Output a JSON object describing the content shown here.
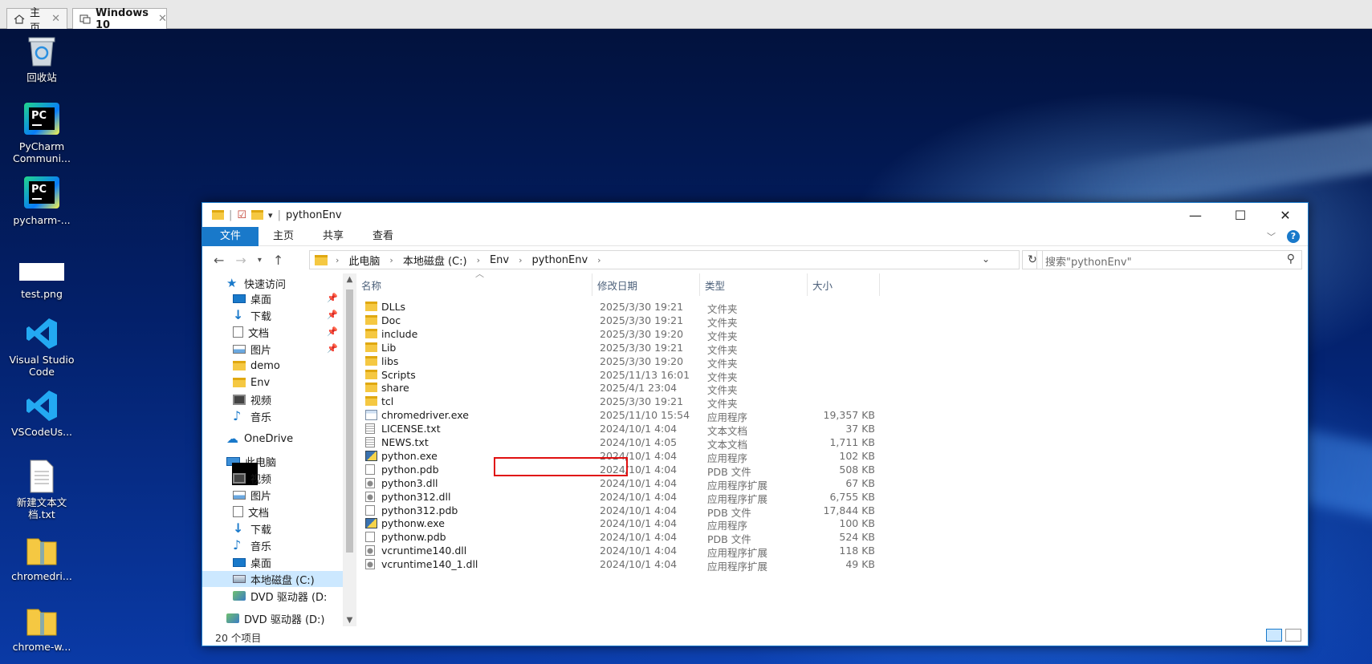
{
  "host_tabs": [
    {
      "label": "主页"
    },
    {
      "label": "Windows 10"
    }
  ],
  "desktop_icons": [
    {
      "label": "回收站"
    },
    {
      "label": "PyCharm Communi..."
    },
    {
      "label": "pycharm-..."
    },
    {
      "label": "test.png"
    },
    {
      "label": "Visual Studio Code"
    },
    {
      "label": "VSCodeUs..."
    },
    {
      "label": "新建文本文档.txt"
    },
    {
      "label": "chromedri..."
    },
    {
      "label": "chrome-w..."
    }
  ],
  "explorer": {
    "title": "pythonEnv",
    "ribbon_tabs": [
      "文件",
      "主页",
      "共享",
      "查看"
    ],
    "breadcrumb": [
      "此电脑",
      "本地磁盘 (C:)",
      "Env",
      "pythonEnv"
    ],
    "search_placeholder": "搜索\"pythonEnv\"",
    "columns": [
      "名称",
      "修改日期",
      "类型",
      "大小"
    ],
    "sidebar": [
      {
        "label": "快速访问",
        "icon": "star-icon"
      },
      {
        "label": "桌面",
        "icon": "desktop-icon",
        "pinned": true
      },
      {
        "label": "下载",
        "icon": "download-icon",
        "pinned": true
      },
      {
        "label": "文档",
        "icon": "document-icon",
        "pinned": true
      },
      {
        "label": "图片",
        "icon": "picture-icon",
        "pinned": true
      },
      {
        "label": "demo",
        "icon": "folder-icon"
      },
      {
        "label": "Env",
        "icon": "folder-icon"
      },
      {
        "label": "视频",
        "icon": "video-icon"
      },
      {
        "label": "音乐",
        "icon": "music-icon"
      },
      {
        "label": "OneDrive",
        "icon": "cloud-icon"
      },
      {
        "label": "此电脑",
        "icon": "computer-icon"
      },
      {
        "label": "视频",
        "icon": "video-icon"
      },
      {
        "label": "图片",
        "icon": "picture-icon"
      },
      {
        "label": "文档",
        "icon": "document-icon"
      },
      {
        "label": "下载",
        "icon": "download-icon"
      },
      {
        "label": "音乐",
        "icon": "music-icon"
      },
      {
        "label": "桌面",
        "icon": "desktop-icon"
      },
      {
        "label": "本地磁盘 (C:)",
        "icon": "disk-icon",
        "selected": true
      },
      {
        "label": "DVD 驱动器 (D:",
        "icon": "dvd-icon"
      },
      {
        "label": "DVD 驱动器 (D:)",
        "icon": "dvd-icon"
      }
    ],
    "files": [
      {
        "name": "DLLs",
        "date": "2025/3/30 19:21",
        "type": "文件夹",
        "size": "",
        "icon": "folder"
      },
      {
        "name": "Doc",
        "date": "2025/3/30 19:21",
        "type": "文件夹",
        "size": "",
        "icon": "folder"
      },
      {
        "name": "include",
        "date": "2025/3/30 19:20",
        "type": "文件夹",
        "size": "",
        "icon": "folder"
      },
      {
        "name": "Lib",
        "date": "2025/3/30 19:21",
        "type": "文件夹",
        "size": "",
        "icon": "folder"
      },
      {
        "name": "libs",
        "date": "2025/3/30 19:20",
        "type": "文件夹",
        "size": "",
        "icon": "folder"
      },
      {
        "name": "Scripts",
        "date": "2025/11/13 16:01",
        "type": "文件夹",
        "size": "",
        "icon": "folder"
      },
      {
        "name": "share",
        "date": "2025/4/1 23:04",
        "type": "文件夹",
        "size": "",
        "icon": "folder"
      },
      {
        "name": "tcl",
        "date": "2025/3/30 19:21",
        "type": "文件夹",
        "size": "",
        "icon": "folder"
      },
      {
        "name": "chromedriver.exe",
        "date": "2025/11/10 15:54",
        "type": "应用程序",
        "size": "19,357 KB",
        "icon": "exe"
      },
      {
        "name": "LICENSE.txt",
        "date": "2024/10/1 4:04",
        "type": "文本文档",
        "size": "37 KB",
        "icon": "txt"
      },
      {
        "name": "NEWS.txt",
        "date": "2024/10/1 4:05",
        "type": "文本文档",
        "size": "1,711 KB",
        "icon": "txt"
      },
      {
        "name": "python.exe",
        "date": "2024/10/1 4:04",
        "type": "应用程序",
        "size": "102 KB",
        "icon": "py"
      },
      {
        "name": "python.pdb",
        "date": "2024/10/1 4:04",
        "type": "PDB 文件",
        "size": "508 KB",
        "icon": "pdb"
      },
      {
        "name": "python3.dll",
        "date": "2024/10/1 4:04",
        "type": "应用程序扩展",
        "size": "67 KB",
        "icon": "dll"
      },
      {
        "name": "python312.dll",
        "date": "2024/10/1 4:04",
        "type": "应用程序扩展",
        "size": "6,755 KB",
        "icon": "dll"
      },
      {
        "name": "python312.pdb",
        "date": "2024/10/1 4:04",
        "type": "PDB 文件",
        "size": "17,844 KB",
        "icon": "pdb"
      },
      {
        "name": "pythonw.exe",
        "date": "2024/10/1 4:04",
        "type": "应用程序",
        "size": "100 KB",
        "icon": "py"
      },
      {
        "name": "pythonw.pdb",
        "date": "2024/10/1 4:04",
        "type": "PDB 文件",
        "size": "524 KB",
        "icon": "pdb"
      },
      {
        "name": "vcruntime140.dll",
        "date": "2024/10/1 4:04",
        "type": "应用程序扩展",
        "size": "118 KB",
        "icon": "dll"
      },
      {
        "name": "vcruntime140_1.dll",
        "date": "2024/10/1 4:04",
        "type": "应用程序扩展",
        "size": "49 KB",
        "icon": "dll"
      }
    ],
    "status": "20 个项目",
    "accent": "#1979ca",
    "highlight_color": "#e01010"
  }
}
